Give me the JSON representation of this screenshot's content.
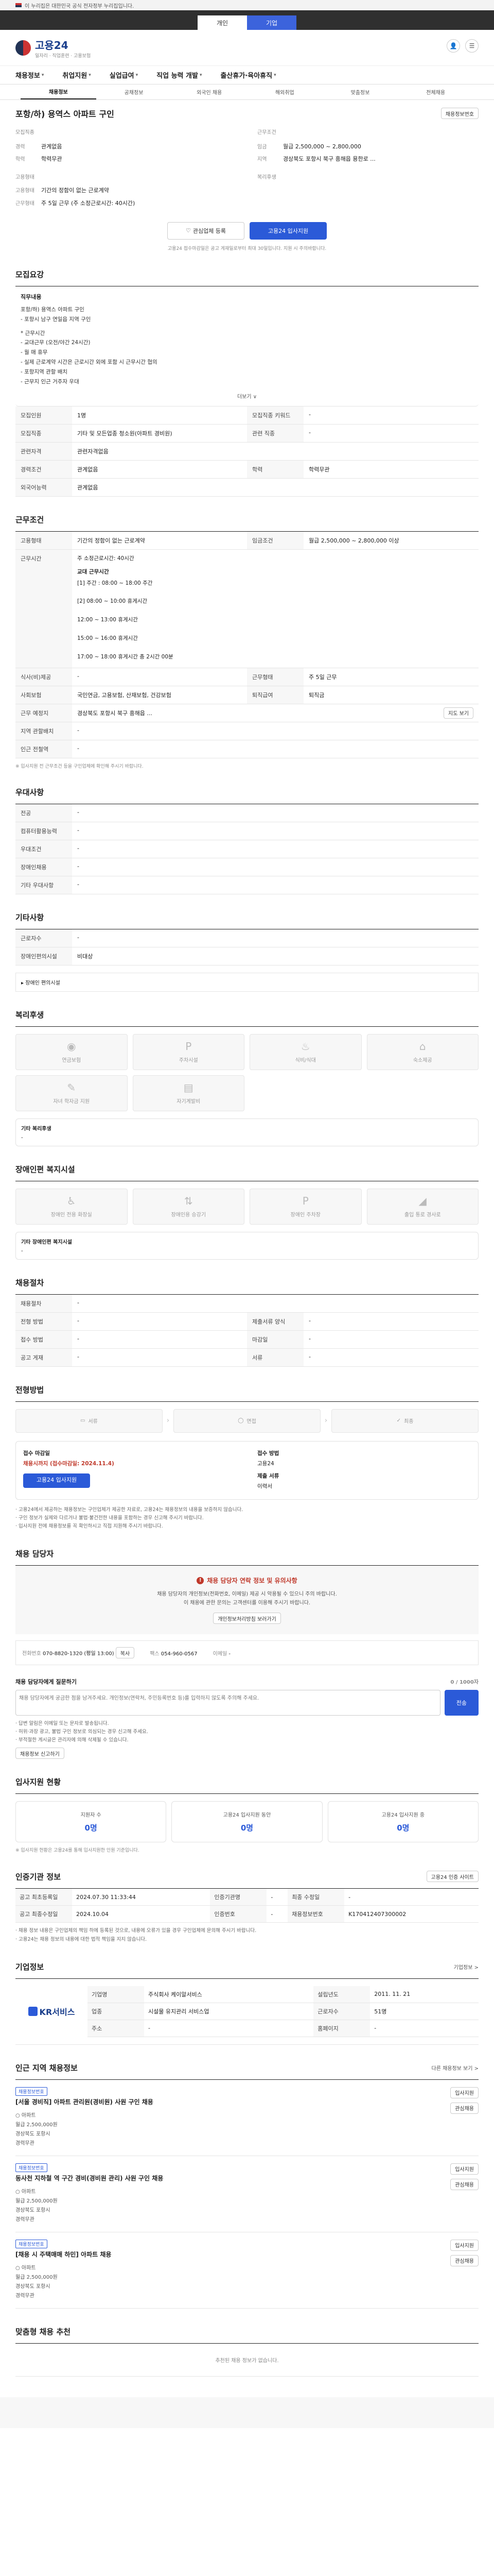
{
  "gov_bar": {
    "text": "이 누리집은 대한민국 공식 전자정부 누리집입니다."
  },
  "access_tabs": [
    {
      "label": "개인"
    },
    {
      "label": "기업"
    }
  ],
  "access_right": "△ 맞춤검색·맞춤알림·전체서비스",
  "brand": {
    "name": "고용24",
    "sub": "일자리 · 직업훈련 · 고용보험"
  },
  "gnb": [
    {
      "label": "채용정보"
    },
    {
      "label": "취업지원"
    },
    {
      "label": "실업급여"
    },
    {
      "label": "직업 능력 개발"
    },
    {
      "label": "출산휴가·육아휴직"
    }
  ],
  "subtabs": [
    "채용정보",
    "공채정보",
    "외국인 채용",
    "해외취업",
    "맞춤정보",
    "전체채용"
  ],
  "job": {
    "title": "포항/하) 용역스 아파트 구인",
    "badge": "채용정보번호",
    "company_label": "모집직종",
    "left_meta": [
      {
        "k": "경력",
        "v": "관계없음"
      },
      {
        "k": "학력",
        "v": "학력무관"
      }
    ],
    "right_title": "근무조건",
    "right_meta": [
      {
        "k": "임금",
        "v": "월급 2,500,000 ~ 2,800,000"
      },
      {
        "k": "지역",
        "v": "경상북도 포항시 북구 흥해읍 용한로 ..."
      }
    ],
    "left_meta2_title": "고용형태",
    "left_meta2": [
      {
        "k": "고용형태",
        "v": "기간의 정함이 없는 근로계약"
      },
      {
        "k": "근무형태",
        "v": "주 5일 근무 (주 소정근로시간: 40시간)"
      }
    ],
    "right_meta2_title": "복리후생",
    "buttons": {
      "save": "관심업체 등록",
      "apply": "고용24 입사지원"
    },
    "note": "고용24 접수마감일은 공고 게재일로부터 최대 30일입니다. 지원 시 주의바랍니다."
  },
  "recruit": {
    "title": "모집요강",
    "duty_title": "직무내용",
    "duties": [
      "포항/하) 용역스 아파트 구인",
      "- 포항시 남구 연일읍 지역 구인",
      "",
      "* 근무시간",
      "- 교대근무 (오전/야간 24시간)",
      "- 월 매 휴무",
      "- 실제 근로계약 시간은 근로시간 외에 포함 시 근무시간 협의",
      "- 포항지역 관할 배치",
      "- 근무지 인근 거주자 우대"
    ],
    "more": "더보기 ∨",
    "rows": [
      [
        {
          "k": "모집인원",
          "v": "1명"
        },
        {
          "k": "모집직종 키워드",
          "v": "-"
        }
      ],
      [
        {
          "k": "모집직종",
          "v": "기타 및 모든업종 청소원(아파트 경비원)"
        },
        {
          "k": "관련 직종",
          "v": "-"
        }
      ],
      [
        {
          "k": "관련자격",
          "v": "관련자격없음"
        },
        {
          "k": "",
          "v": ""
        }
      ],
      [
        {
          "k": "경력조건",
          "v": "관계없음"
        },
        {
          "k": "학력",
          "v": "학력무관"
        }
      ],
      [
        {
          "k": "외국어능력",
          "v": "관계없음"
        },
        {
          "k": "",
          "v": ""
        }
      ]
    ]
  },
  "conditions": {
    "title": "근무조건",
    "rows": [
      [
        {
          "k": "고용형태",
          "v": "기간의 정함이 없는 근로계약"
        },
        {
          "k": "임금조건",
          "v": "월급 2,500,000 ~ 2,800,000 이상"
        }
      ],
      [
        {
          "k": "근무시간",
          "v": "주 소정근로시간: 40시간"
        },
        {
          "k": "",
          "v": ""
        }
      ]
    ],
    "schedule_title": "교대 근무시간",
    "schedule": [
      "[1] 주간 : 08:00 ~ 18:00 주간",
      "[2] 08:00 ~ 10:00 휴게시간",
      "12:00 ~ 13:00 휴게시간",
      "15:00 ~ 16:00 휴게시간",
      "17:00 ~ 18:00 휴게시간 총 2시간 00분"
    ],
    "rows2": [
      [
        {
          "k": "식사(비)제공",
          "v": "-"
        },
        {
          "k": "근무형태",
          "v": "주 5일 근무"
        }
      ],
      [
        {
          "k": "사회보험",
          "v": "국민연금, 고용보험, 산재보험, 건강보험"
        },
        {
          "k": "퇴직급여",
          "v": "퇴직금"
        }
      ],
      [
        {
          "k": "근무 예정지",
          "v": "경상북도 포항시 북구 흥해읍 ..."
        },
        {
          "k": "",
          "v": "지도 보기"
        }
      ],
      [
        {
          "k": "지역 관할배치",
          "v": "-"
        },
        {
          "k": "",
          "v": ""
        }
      ],
      [
        {
          "k": "인근 전철역",
          "v": "-"
        },
        {
          "k": "",
          "v": ""
        }
      ]
    ],
    "note": "※ 입사지원 전 근무조건 등을 구인업체에 확인해 주시기 바랍니다."
  },
  "prefer": {
    "title": "우대사항",
    "rows": [
      {
        "k": "전공",
        "v": "-"
      },
      {
        "k": "컴퓨터활용능력",
        "v": "-"
      },
      {
        "k": "우대조건",
        "v": "-"
      },
      {
        "k": "장애인채용",
        "v": "-"
      },
      {
        "k": "기타 우대사항",
        "v": "-"
      }
    ]
  },
  "etc": {
    "title": "기타사항",
    "rows": [
      {
        "k": "근로자수",
        "v": "-"
      },
      {
        "k": "장애인편의시설",
        "v": "비대상"
      }
    ],
    "more_link": "▸ 장애인 편의시설"
  },
  "welfare": {
    "title": "복리후생",
    "items": [
      "연금보험",
      "주차시설",
      "식비/식대",
      "숙소제공",
      "자녀 학자금 지원",
      "자기계발비",
      "건강검진",
      "자녀 보육시설"
    ],
    "etc_label": "기타 복리후생",
    "etc_value": "-"
  },
  "disabled": {
    "title": "장애인편 복지시설",
    "items": [
      "장애인 전용 화장실",
      "장애인용 승강기",
      "장애인 주차장",
      "출입 통로 경사로"
    ],
    "etc_label": "기타 장애인편 복지시설",
    "etc_value": "-"
  },
  "process": {
    "title": "채용절차",
    "rows": [
      [
        {
          "k": "채용절차",
          "v": "-"
        },
        {
          "k": "",
          "v": ""
        }
      ],
      [
        {
          "k": "전형 방법",
          "v": "-"
        },
        {
          "k": "제출서류 양식",
          "v": "-"
        }
      ],
      [
        {
          "k": "접수 방법",
          "v": "-"
        },
        {
          "k": "마감일",
          "v": "-"
        }
      ],
      [
        {
          "k": "공고 게재",
          "v": "-"
        },
        {
          "k": "서류",
          "v": "-"
        }
      ]
    ]
  },
  "apply": {
    "title": "전형방법",
    "steps": [
      "서류",
      "면접",
      "최종"
    ],
    "method_label": "접수 마감일",
    "method_value": "채용시까지 (접수마감일: 2024.11.4)",
    "channel_label": "접수 방법",
    "channel_value": "고용24",
    "doc_label": "제출 서류",
    "doc_value": "이력서",
    "apply_btn": "고용24 입사지원",
    "notes": [
      "고용24에서 제공하는 채용정보는 구인업체가 제공한 자료로, 고용24는 채용정보의 내용을 보증하지 않습니다.",
      "구인 정보가 실제와 다르거나 불법·불건전한 내용을 포함하는 경우 신고해 주시기 바랍니다.",
      "입사지원 전에 채용정보를 꼭 확인하시고 직접 지원해 주시기 바랍니다."
    ]
  },
  "contact": {
    "title": "채용 담당자",
    "alert": "채용 담당자 연락 정보 및 유의사항",
    "desc1": "채용 담당자의 개인정보(전화번호, 이메일) 제공 시 악용될 수 있으니 주의 바랍니다.",
    "desc2": "이 채용에 관한 문의는 고객센터를 이용해 주시기 바랍니다.",
    "btn_info": "개인정보처리방침 보러가기",
    "phone_label": "전화번호",
    "phone_value": "070-8820-1320 (평일 13:00)",
    "fax_label": "팩스",
    "fax_value": "054-960-0567",
    "email_label": "이메일",
    "email_value": "-",
    "copy_btn": "복사"
  },
  "report": {
    "title": "채용 담당자에게 질문하기",
    "count": "0 / 1000자",
    "placeholder": "채용 담당자에게 궁금한 점을 남겨주세요. 개인정보(연락처, 주민등록번호 등)를 입력하지 않도록 주의해 주세요.",
    "submit": "전송",
    "notes": [
      "답변 알림은 이메일 또는 문자로 발송됩니다.",
      "허위·과장 광고, 불법 구인 정보로 의심되는 경우 신고해 주세요.",
      "부적절한 게시글은 관리자에 의해 삭제될 수 있습니다."
    ],
    "report_btn": "채용정보 신고하기"
  },
  "stats": {
    "title": "입사지원 현황",
    "cards": [
      {
        "label": "지원자 수",
        "value": "0명"
      },
      {
        "label": "고용24 입사지원 동안",
        "value": "0명"
      },
      {
        "label": "고용24 입사지원 중",
        "value": "0명"
      }
    ],
    "note": "※ 입사지원 현황은 고용24를 통해 입사지원한 인원 기준입니다."
  },
  "info": {
    "title": "인증기관 정보",
    "btn": "고용24 인증 사이트",
    "rows": [
      [
        {
          "k": "공고 최초등록일",
          "v": "2024.07.30 11:33:44"
        },
        {
          "k": "인증기관명",
          "v": "-"
        },
        {
          "k": "최종 수정일",
          "v": "-"
        }
      ],
      [
        {
          "k": "공고 최종수정일",
          "v": "2024.10.04"
        },
        {
          "k": "인증번호",
          "v": "-"
        },
        {
          "k": "채용정보번호",
          "v": "K170412407300002"
        }
      ]
    ],
    "notes": [
      "채용 정보 내용은 구인업체의 책임 하에 등록된 것으로, 내용에 오류가 있을 경우 구인업체에 문의해 주시기 바랍니다.",
      "고용24는 채용 정보의 내용에 대한 법적 책임을 지지 않습니다."
    ]
  },
  "company": {
    "title": "기업정보",
    "more": "기업정보 >",
    "name": "KR서비스",
    "rows": [
      [
        {
          "k": "기업명",
          "v": "주식회사 케이알서비스"
        },
        {
          "k": "설립년도",
          "v": "2011. 11. 21"
        }
      ],
      [
        {
          "k": "업종",
          "v": "시설물 유지관리 서비스업"
        },
        {
          "k": "근로자수",
          "v": "51명"
        }
      ],
      [
        {
          "k": "주소",
          "v": "-"
        },
        {
          "k": "홈페이지",
          "v": "-"
        }
      ]
    ]
  },
  "similar": {
    "title": "인근 지역 채용정보",
    "more": "다른 채용정보 보기 >",
    "jobs": [
      {
        "tag": "채용정보번호",
        "title": "[서울 경비직] 아파트 관리원(경비원) 사원 구인 채용",
        "company": "○ 아파트",
        "wage": "월급 2,500,000원",
        "loc": "경상북도 포항시",
        "career": "경력무관"
      },
      {
        "tag": "채용정보번호",
        "title": "동사천 지하철 역 구간 경비(경비원 관리) 사원 구인 채용",
        "company": "○ 아파트",
        "wage": "월급 2,500,000원",
        "loc": "경상북도 포항시",
        "career": "경력무관"
      },
      {
        "tag": "채용정보번호",
        "title": "[채용 시 주택매매 하민] 아파트 채용",
        "company": "○ 아파트",
        "wage": "월급 2,500,000원",
        "loc": "경상북도 포항시",
        "career": "경력무관"
      }
    ],
    "btn_apply": "입사지원",
    "btn_save": "관심채용"
  },
  "bottom": {
    "title": "맞춤형 채용 추천",
    "empty": "추천된 채용 정보가 없습니다."
  }
}
